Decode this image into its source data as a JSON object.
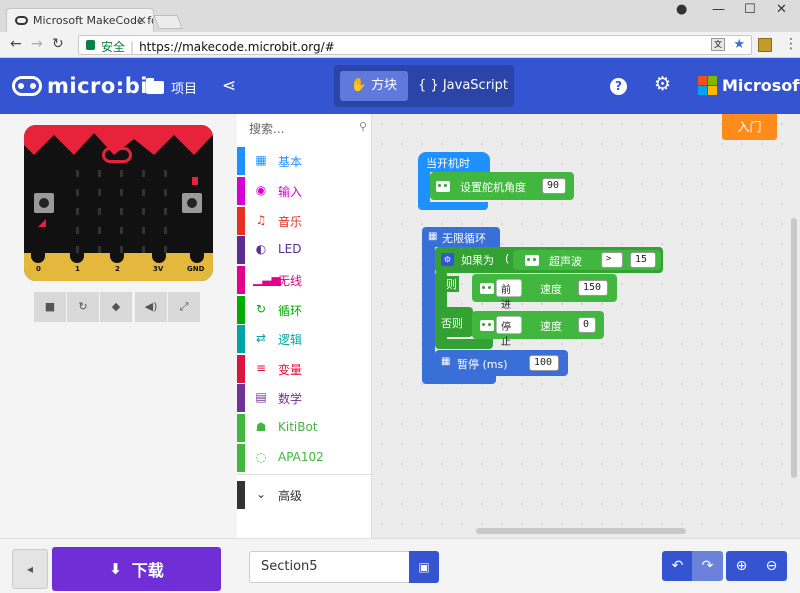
{
  "browser": {
    "tab_title": "Microsoft MakeCode fo",
    "security_label": "安全",
    "url": "https://makecode.microbit.org/#"
  },
  "header": {
    "logo_text": "micro:bit",
    "projects_label": "项目",
    "toggle_blocks": "方块",
    "toggle_js": "JavaScript",
    "brand": "Microsoft"
  },
  "simulator": {
    "pins": [
      "0",
      "1",
      "2",
      "3V",
      "GND"
    ]
  },
  "toolbox": {
    "search_placeholder": "搜索...",
    "categories": [
      {
        "label": "基本",
        "color": "#1e90ff",
        "icon": "grid-icon"
      },
      {
        "label": "输入",
        "color": "#d400d4",
        "icon": "target-icon"
      },
      {
        "label": "音乐",
        "color": "#e63022",
        "icon": "headphones-icon"
      },
      {
        "label": "LED",
        "color": "#5c2d91",
        "icon": "toggle-icon"
      },
      {
        "label": "无线",
        "color": "#e3008c",
        "icon": "signal-icon"
      },
      {
        "label": "循环",
        "color": "#00aa00",
        "icon": "loop-icon"
      },
      {
        "label": "逻辑",
        "color": "#00a4a6",
        "icon": "shuffle-icon"
      },
      {
        "label": "变量",
        "color": "#dc143c",
        "icon": "list-icon"
      },
      {
        "label": "数学",
        "color": "#703296",
        "icon": "calculator-icon"
      },
      {
        "label": "KitiBot",
        "color": "#41b73f",
        "icon": "robot-icon"
      },
      {
        "label": "APA102",
        "color": "#41b73f",
        "icon": "ring-icon"
      }
    ],
    "advanced_label": "高级"
  },
  "workspace": {
    "intro_button": "入门",
    "on_start": "当开机时",
    "servo_label": "设置舵机角度",
    "servo_value": "90",
    "forever": "无限循环",
    "if_label": "如果为",
    "paren": "(",
    "ultrasonic": "超声波",
    "operator": ">",
    "compare_value": "15",
    "then_label": "则",
    "forward": "前进",
    "speed_label": "速度",
    "forward_speed": "150",
    "else_label": "否则",
    "stop": "停止",
    "stop_speed": "0",
    "pause_label": "暂停 (ms)",
    "pause_value": "100"
  },
  "footer": {
    "download_label": "下载",
    "project_name": "Section5"
  }
}
